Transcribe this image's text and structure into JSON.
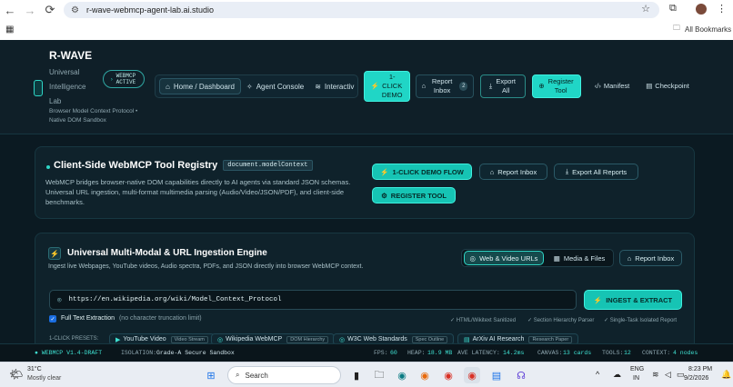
{
  "browser": {
    "url": "r-wave-webmcp-agent-lab.ai.studio",
    "bookmarks_label": "All Bookmarks"
  },
  "header": {
    "brand": "R-WAVE",
    "brand_lines": [
      "Universal",
      "Intelligence",
      "Lab"
    ],
    "brand_tagline": "Browser Model Context Protocol • Native DOM Sandbox",
    "active_pill": "WEBMCP ACTIVE",
    "nav": [
      "Home / Dashboard",
      "Agent Console",
      "Interactiv"
    ],
    "btn_demo": "1-CLICK DEMO",
    "btn_report": "Report Inbox",
    "report_count": "2",
    "btn_export": "Export All",
    "btn_register": "Register Tool",
    "btn_manifest": "Manifest",
    "btn_checkpoint": "Checkpoint"
  },
  "registry": {
    "title": "Client-Side WebMCP Tool Registry",
    "code_tag": "document.modelContext",
    "description": "WebMCP bridges browser-native DOM capabilities directly to AI agents via standard JSON schemas. Universal URL ingestion, multi-format multimedia parsing (Audio/Video/JSON/PDF), and client-side benchmarks.",
    "btn_demo_flow": "1-CLICK DEMO FLOW",
    "btn_report_inbox": "Report Inbox",
    "btn_export_reports": "Export All Reports",
    "btn_register_tool": "REGISTER TOOL"
  },
  "ingest": {
    "title": "Universal Multi-Modal & URL Ingestion Engine",
    "subtitle": "Ingest live Webpages, YouTube videos, Audio spectra, PDFs, and JSON directly into browser WebMCP context.",
    "tab_web": "Web & Video URLs",
    "tab_media": "Media & Files",
    "btn_report_inbox": "Report Inbox",
    "url_value": "https://en.wikipedia.org/wiki/Model_Context_Protocol",
    "btn_ingest": "INGEST & EXTRACT",
    "fulltext_label": "Full Text Extraction",
    "fulltext_note": "(no character truncation limit)",
    "badges": [
      "✓ HTML/Wikitext Sanitized",
      "✓ Section Hierarchy Parser",
      "✓ Single-Task Isolated Report"
    ],
    "presets_label": "1-CLICK PRESETS:",
    "presets": [
      {
        "label": "YouTube Video",
        "tag": "Video Stream"
      },
      {
        "label": "Wikipedia WebMCP",
        "tag": "DOM Hierarchy"
      },
      {
        "label": "W3C Web Standards",
        "tag": "Spec Outline"
      },
      {
        "label": "ArXiv AI Research",
        "tag": "Research Paper"
      }
    ]
  },
  "status": {
    "version": "● WEBMCP V1.4-DRAFT",
    "isolation_label": "ISOLATION:",
    "isolation_value": "Grade-A Secure Sandbox",
    "fps_label": "FPS:",
    "fps": "60",
    "heap_label": "HEAP:",
    "heap": "18.9 MB",
    "latency_label": "AVE LATENCY:",
    "latency": "14.2ms",
    "canvas_label": "CANVAS:",
    "canvas": "13 cards",
    "tools_label": "TOOLS:",
    "tools": "12",
    "context_label": "CONTEXT:",
    "context": "4 nodes"
  },
  "taskbar": {
    "weather_temp": "31°C",
    "weather_desc": "Mostly clear",
    "search_placeholder": "Search",
    "lang": "ENG",
    "lang2": "IN",
    "time": "8:23 PM",
    "date": "9/2/2026"
  }
}
